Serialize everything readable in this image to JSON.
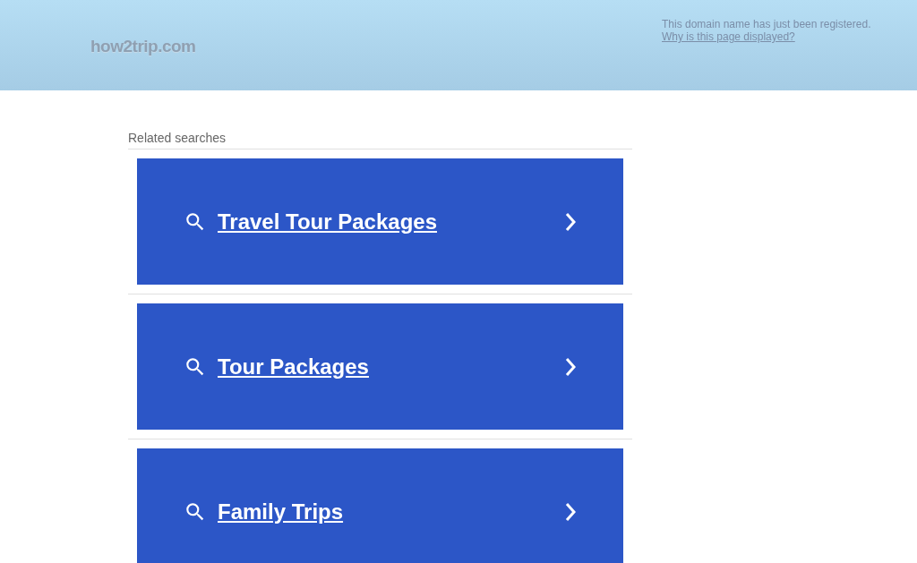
{
  "header": {
    "logo": "how2trip.com",
    "notice": "This domain name has just been registered.",
    "notice_link": "Why is this page displayed?"
  },
  "related": {
    "title": "Related searches",
    "items": [
      {
        "label": "Travel Tour Packages"
      },
      {
        "label": "Tour Packages"
      },
      {
        "label": "Family Trips"
      }
    ]
  }
}
